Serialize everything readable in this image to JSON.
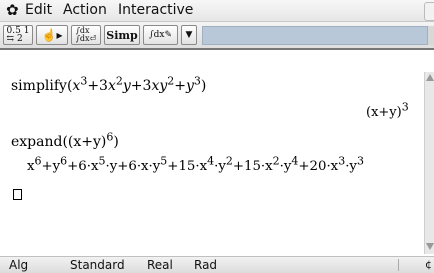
{
  "menubar": {
    "items": [
      "Edit",
      "Action",
      "Interactive"
    ],
    "gear_icon": "gear-icon"
  },
  "toolbar": {
    "buttons": [
      {
        "name": "fraction-decimal-toggle",
        "label": "0.5 ½"
      },
      {
        "name": "pan-pointer",
        "label": "☝▸"
      },
      {
        "name": "integral-convert",
        "label": "∫dx"
      },
      {
        "name": "simp",
        "label": "Simp"
      },
      {
        "name": "integral-pen",
        "label": "∫dx"
      },
      {
        "name": "dropdown",
        "label": "▼"
      }
    ]
  },
  "work": {
    "input1": {
      "func": "simplify",
      "expr_prefix": "(x",
      "result": "(x+y)"
    },
    "input2": {
      "text": "expand((x+y)"
    },
    "output2": {
      "text": "x⁶+y⁶+6·x⁵·y+6·x·y⁵+15·x⁴·y²+15·x²·y⁴+20·x³·y³"
    }
  },
  "status": {
    "items": [
      "Alg",
      "Standard",
      "Real",
      "Rad"
    ]
  }
}
